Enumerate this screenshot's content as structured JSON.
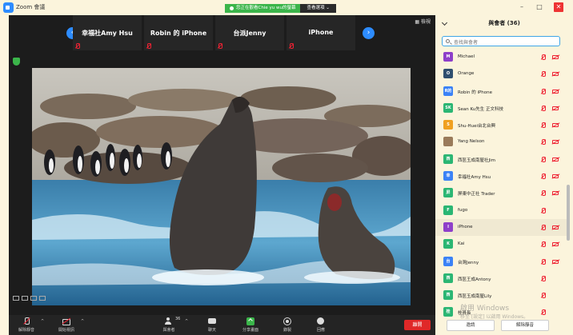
{
  "window": {
    "title": "Zoom 會議",
    "share_status": "您正在觀看Chie yu wu的螢幕",
    "view_options": "查看選項 ⌄"
  },
  "filmstrip": {
    "participants": [
      {
        "name": "幸福社Amy Hsu"
      },
      {
        "name": "Robin 的 iPhone"
      },
      {
        "name": "台派Jenny"
      },
      {
        "name": "iPhone"
      }
    ],
    "gallery_label": "▦ 檢視"
  },
  "panel": {
    "title": "與會者 (36)",
    "search_placeholder": "查找與會者",
    "participants": [
      {
        "initials": "M",
        "name": "Michael",
        "color": "#8e3fc9",
        "video_off": true
      },
      {
        "initials": "O",
        "name": "Orange",
        "color": "#2f4f6f",
        "video_off": true
      },
      {
        "initials": "R的",
        "name": "Robin 的 iPhone",
        "color": "#3b82f6",
        "video_off": true
      },
      {
        "initials": "SK",
        "name": "Sean Ku先生 正文科技",
        "color": "#2bb673",
        "video_off": true
      },
      {
        "initials": "S",
        "name": "Shu-Huei台北台興",
        "color": "#f0a020",
        "video_off": true
      },
      {
        "initials": "",
        "name": "Yang Nelson",
        "color": "#9a7b5a",
        "video_off": true
      },
      {
        "initials": "西",
        "name": "西區玉成南屋社Jim",
        "color": "#2bb673",
        "video_off": true
      },
      {
        "initials": "幸",
        "name": "幸福社Amy Hsu",
        "color": "#3b82f6",
        "video_off": true
      },
      {
        "initials": "屏",
        "name": "屏東中正社 Trader",
        "color": "#2bb673",
        "video_off": true
      },
      {
        "initials": "F",
        "name": "fugo",
        "color": "#2bb673",
        "video_off": false
      },
      {
        "initials": "I",
        "name": "iPhone",
        "color": "#8e3fc9",
        "video_off": true
      },
      {
        "initials": "K",
        "name": "Kai",
        "color": "#2bb673",
        "video_off": true
      },
      {
        "initials": "台",
        "name": "台灣Jenny",
        "color": "#3b82f6",
        "video_off": true
      },
      {
        "initials": "西",
        "name": "西區王成Antony",
        "color": "#2bb673",
        "video_off": false
      },
      {
        "initials": "西",
        "name": "西區玉成南屋Lily",
        "color": "#2bb673",
        "video_off": false
      },
      {
        "initials": "桂",
        "name": "桂員長",
        "color": "#2bb673",
        "video_off": false
      }
    ],
    "invite_label": "邀請",
    "mute_all_label": "解除靜音"
  },
  "watermark": {
    "line1": "啟用 Windows",
    "line2": "移至 [設定] 以啟用 Windows。"
  },
  "toolbar": {
    "unmute_label": "解除靜音",
    "start_video_label": "開始視訊",
    "participants_label": "與會者",
    "participants_count": "36",
    "chat_label": "聊天",
    "share_label": "分享畫面",
    "record_label": "錄製",
    "reactions_label": "回應",
    "end_label": "離開"
  }
}
